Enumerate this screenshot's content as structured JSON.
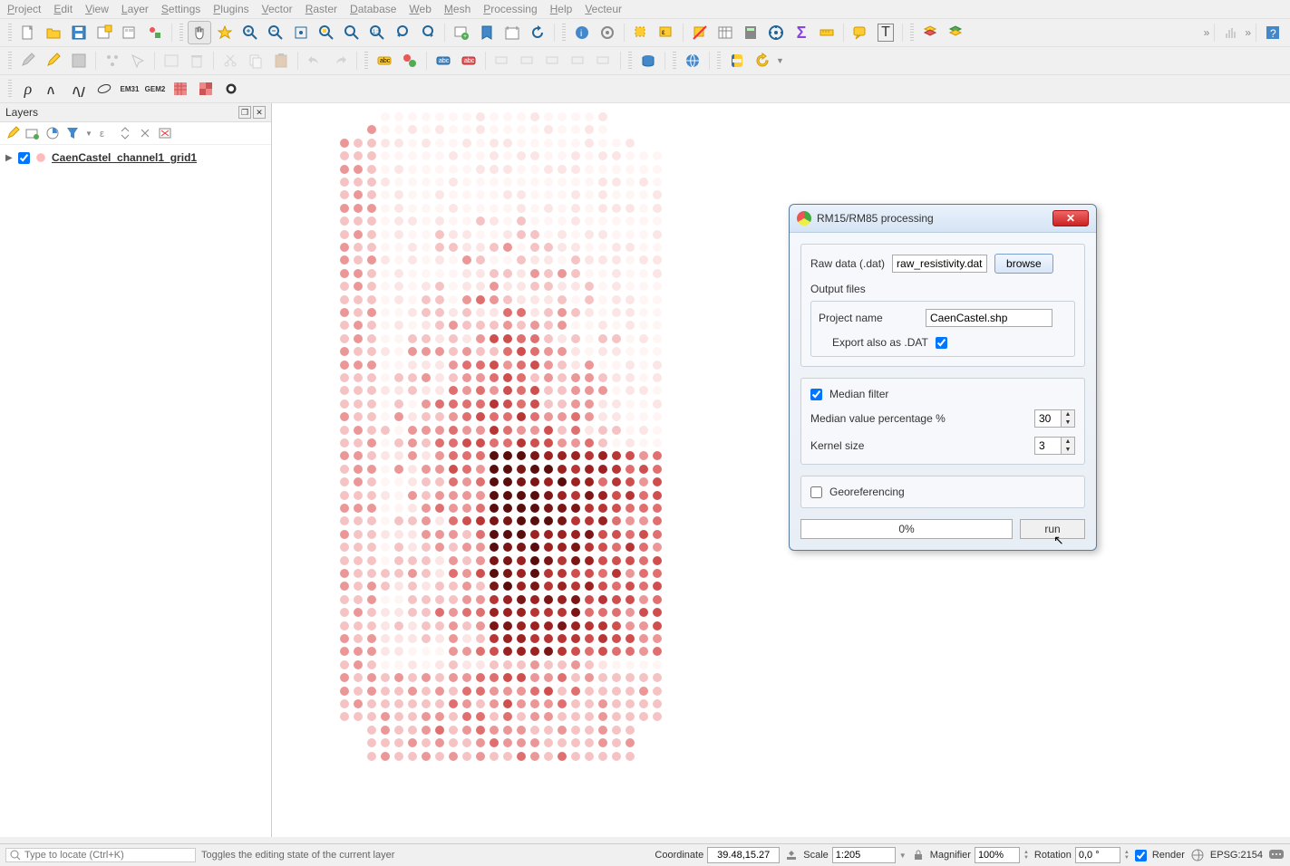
{
  "menu": {
    "items": [
      "Project",
      "Edit",
      "View",
      "Layer",
      "Settings",
      "Plugins",
      "Vector",
      "Raster",
      "Database",
      "Web",
      "Mesh",
      "Processing",
      "Help",
      "Vecteur"
    ]
  },
  "layers_panel": {
    "title": "Layers",
    "layer_name": "CaenCastel_channel1_grid1"
  },
  "dialog": {
    "title": "RM15/RM85 processing",
    "raw_label": "Raw data (.dat)",
    "raw_value": "raw_resistivity.dat",
    "browse": "browse",
    "output_label": "Output files",
    "project_label": "Project name",
    "project_value": "CaenCastel.shp",
    "export_label": "Export also as .DAT",
    "export_checked": true,
    "median_label": "Median filter",
    "median_checked": true,
    "median_pct_label": "Median value percentage %",
    "median_pct_value": "30",
    "kernel_label": "Kernel size",
    "kernel_value": "3",
    "georef_label": "Georeferencing",
    "georef_checked": false,
    "progress": "0%",
    "run": "run"
  },
  "status": {
    "search_placeholder": "Type to locate (Ctrl+K)",
    "message": "Toggles the editing state of the current layer",
    "coord_label": "Coordinate",
    "coord_value": "39.48,15.27",
    "scale_label": "Scale",
    "scale_value": "1:205",
    "magnifier_label": "Magnifier",
    "magnifier_value": "100%",
    "rotation_label": "Rotation",
    "rotation_value": "0,0 °",
    "render_label": "Render",
    "crs": "EPSG:2154"
  }
}
